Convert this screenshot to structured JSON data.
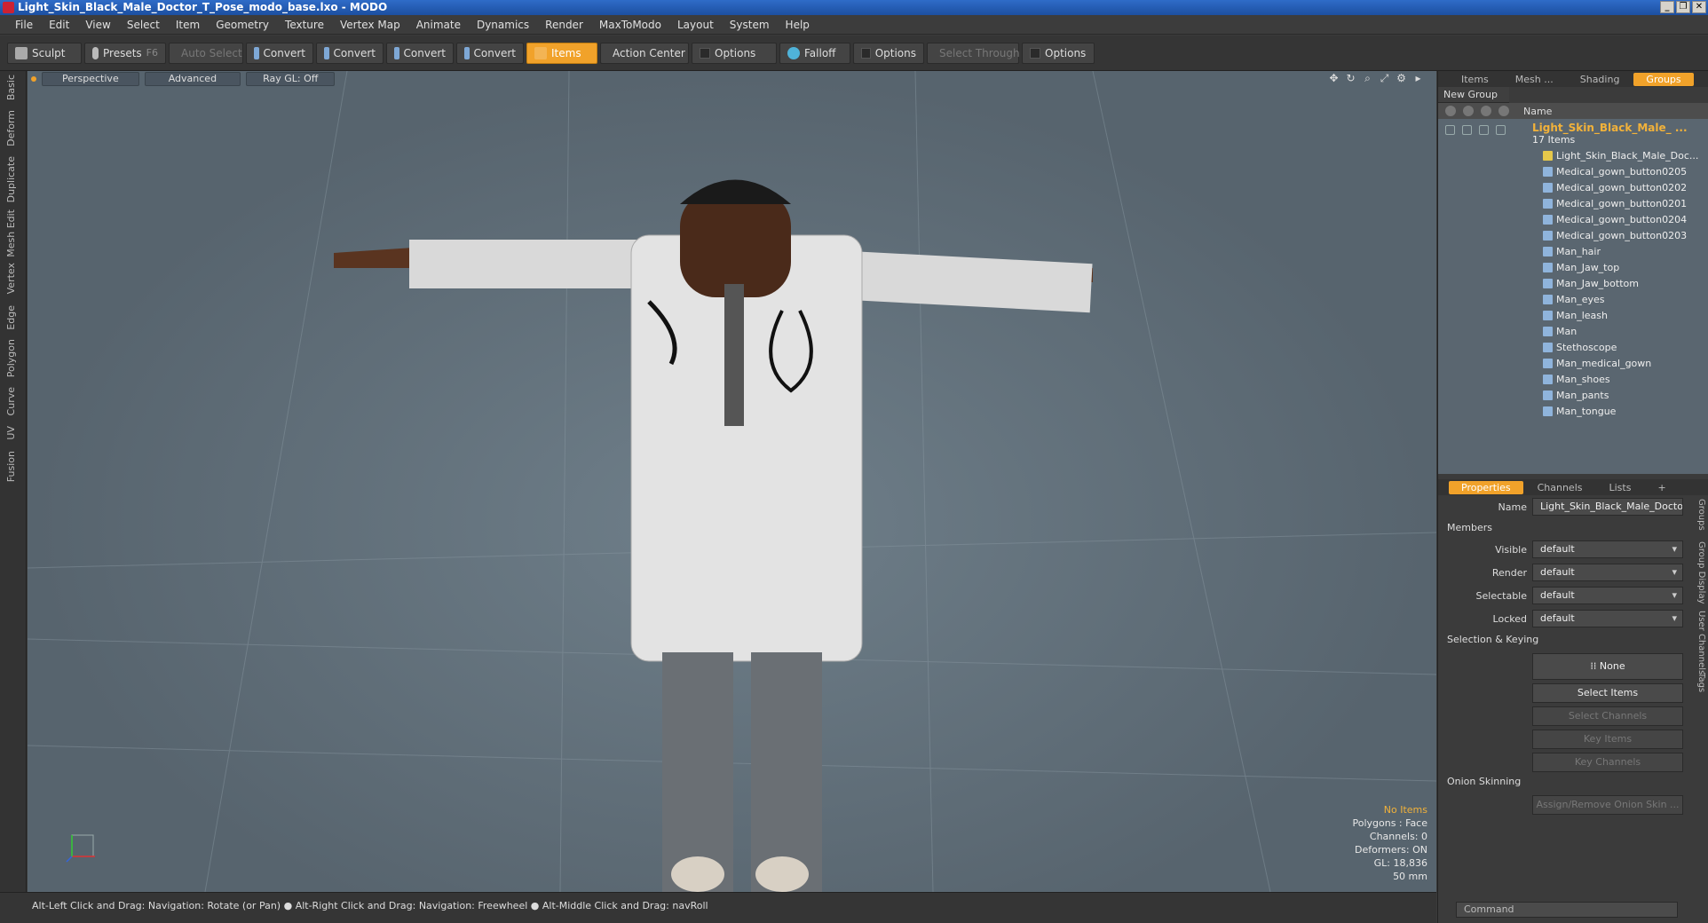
{
  "window": {
    "title": "Light_Skin_Black_Male_Doctor_T_Pose_modo_base.lxo - MODO"
  },
  "menu": [
    "File",
    "Edit",
    "View",
    "Select",
    "Item",
    "Geometry",
    "Texture",
    "Vertex Map",
    "Animate",
    "Dynamics",
    "Render",
    "MaxToModo",
    "Layout",
    "System",
    "Help"
  ],
  "toolbar": {
    "sculpt": "Sculpt",
    "presets": "Presets",
    "presets_key": "F6",
    "auto_select": "Auto Select",
    "convert1": "Convert",
    "convert2": "Convert",
    "convert3": "Convert",
    "convert4": "Convert",
    "items": "Items",
    "action_center": "Action Center",
    "options1": "Options",
    "falloff": "Falloff",
    "options2": "Options",
    "select_through": "Select Through",
    "options3": "Options"
  },
  "left_tabs": [
    "Basic",
    "Deform",
    "Duplicate",
    "Mesh Edit",
    "Vertex",
    "Edge",
    "Polygon",
    "Curve",
    "UV",
    "Fusion"
  ],
  "viewport": {
    "view": "Perspective",
    "shading": "Advanced",
    "raygl": "Ray GL: Off",
    "info": {
      "items": "No Items",
      "polygons": "Polygons : Face",
      "channels": "Channels: 0",
      "deformers": "Deformers: ON",
      "gl": "GL: 18,836",
      "lens": "50 mm"
    }
  },
  "status": "Alt-Left Click and Drag: Navigation: Rotate (or Pan) ● Alt-Right Click and Drag: Navigation: Freewheel ● Alt-Middle Click and Drag: navRoll",
  "panel": {
    "tabs": [
      "Items",
      "Mesh ...",
      "Shading",
      "Groups"
    ],
    "new_group": "New Group",
    "name_col": "Name",
    "group_name": "Light_Skin_Black_Male_ ...",
    "group_count": "17 Items",
    "items": [
      "Light_Skin_Black_Male_Doc...",
      "Medical_gown_button0205",
      "Medical_gown_button0202",
      "Medical_gown_button0201",
      "Medical_gown_button0204",
      "Medical_gown_button0203",
      "Man_hair",
      "Man_Jaw_top",
      "Man_Jaw_bottom",
      "Man_eyes",
      "Man_leash",
      "Man",
      "Stethoscope",
      "Man_medical_gown",
      "Man_shoes",
      "Man_pants",
      "Man_tongue"
    ]
  },
  "props": {
    "tabs": [
      "Properties",
      "Channels",
      "Lists",
      "+"
    ],
    "name_label": "Name",
    "name_value": "Light_Skin_Black_Male_Doctor_T",
    "members": "Members",
    "visible_label": "Visible",
    "visible": "default",
    "render_label": "Render",
    "render": "default",
    "selectable_label": "Selectable",
    "selectable": "default",
    "locked_label": "Locked",
    "locked": "default",
    "sel_keying": "Selection & Keying",
    "none": "None",
    "select_items": "Select Items",
    "select_channels": "Select Channels",
    "key_items": "Key Items",
    "key_channels": "Key Channels",
    "onion": "Onion Skinning",
    "assign_onion": "Assign/Remove Onion Skin ...",
    "command": "Command",
    "side_tabs": [
      "Groups",
      "Group Display",
      "User Channels",
      "Tags"
    ]
  }
}
